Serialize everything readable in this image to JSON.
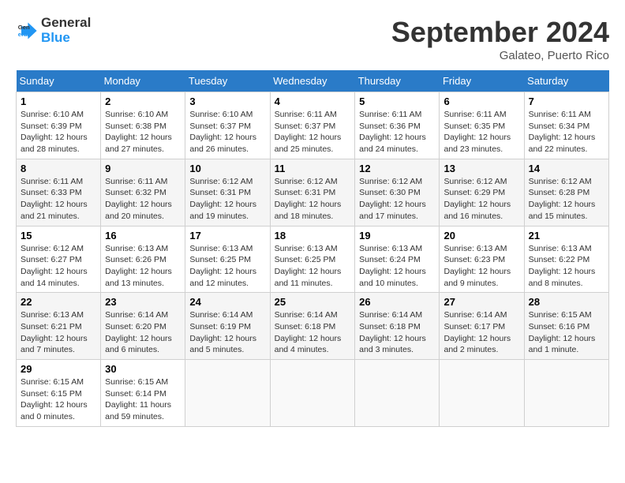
{
  "header": {
    "logo_line1": "General",
    "logo_line2": "Blue",
    "month_title": "September 2024",
    "location": "Galateo, Puerto Rico"
  },
  "days_of_week": [
    "Sunday",
    "Monday",
    "Tuesday",
    "Wednesday",
    "Thursday",
    "Friday",
    "Saturday"
  ],
  "weeks": [
    [
      {
        "day": "1",
        "sunrise": "6:10 AM",
        "sunset": "6:39 PM",
        "daylight": "12 hours and 28 minutes."
      },
      {
        "day": "2",
        "sunrise": "6:10 AM",
        "sunset": "6:38 PM",
        "daylight": "12 hours and 27 minutes."
      },
      {
        "day": "3",
        "sunrise": "6:10 AM",
        "sunset": "6:37 PM",
        "daylight": "12 hours and 26 minutes."
      },
      {
        "day": "4",
        "sunrise": "6:11 AM",
        "sunset": "6:37 PM",
        "daylight": "12 hours and 25 minutes."
      },
      {
        "day": "5",
        "sunrise": "6:11 AM",
        "sunset": "6:36 PM",
        "daylight": "12 hours and 24 minutes."
      },
      {
        "day": "6",
        "sunrise": "6:11 AM",
        "sunset": "6:35 PM",
        "daylight": "12 hours and 23 minutes."
      },
      {
        "day": "7",
        "sunrise": "6:11 AM",
        "sunset": "6:34 PM",
        "daylight": "12 hours and 22 minutes."
      }
    ],
    [
      {
        "day": "8",
        "sunrise": "6:11 AM",
        "sunset": "6:33 PM",
        "daylight": "12 hours and 21 minutes."
      },
      {
        "day": "9",
        "sunrise": "6:11 AM",
        "sunset": "6:32 PM",
        "daylight": "12 hours and 20 minutes."
      },
      {
        "day": "10",
        "sunrise": "6:12 AM",
        "sunset": "6:31 PM",
        "daylight": "12 hours and 19 minutes."
      },
      {
        "day": "11",
        "sunrise": "6:12 AM",
        "sunset": "6:31 PM",
        "daylight": "12 hours and 18 minutes."
      },
      {
        "day": "12",
        "sunrise": "6:12 AM",
        "sunset": "6:30 PM",
        "daylight": "12 hours and 17 minutes."
      },
      {
        "day": "13",
        "sunrise": "6:12 AM",
        "sunset": "6:29 PM",
        "daylight": "12 hours and 16 minutes."
      },
      {
        "day": "14",
        "sunrise": "6:12 AM",
        "sunset": "6:28 PM",
        "daylight": "12 hours and 15 minutes."
      }
    ],
    [
      {
        "day": "15",
        "sunrise": "6:12 AM",
        "sunset": "6:27 PM",
        "daylight": "12 hours and 14 minutes."
      },
      {
        "day": "16",
        "sunrise": "6:13 AM",
        "sunset": "6:26 PM",
        "daylight": "12 hours and 13 minutes."
      },
      {
        "day": "17",
        "sunrise": "6:13 AM",
        "sunset": "6:25 PM",
        "daylight": "12 hours and 12 minutes."
      },
      {
        "day": "18",
        "sunrise": "6:13 AM",
        "sunset": "6:25 PM",
        "daylight": "12 hours and 11 minutes."
      },
      {
        "day": "19",
        "sunrise": "6:13 AM",
        "sunset": "6:24 PM",
        "daylight": "12 hours and 10 minutes."
      },
      {
        "day": "20",
        "sunrise": "6:13 AM",
        "sunset": "6:23 PM",
        "daylight": "12 hours and 9 minutes."
      },
      {
        "day": "21",
        "sunrise": "6:13 AM",
        "sunset": "6:22 PM",
        "daylight": "12 hours and 8 minutes."
      }
    ],
    [
      {
        "day": "22",
        "sunrise": "6:13 AM",
        "sunset": "6:21 PM",
        "daylight": "12 hours and 7 minutes."
      },
      {
        "day": "23",
        "sunrise": "6:14 AM",
        "sunset": "6:20 PM",
        "daylight": "12 hours and 6 minutes."
      },
      {
        "day": "24",
        "sunrise": "6:14 AM",
        "sunset": "6:19 PM",
        "daylight": "12 hours and 5 minutes."
      },
      {
        "day": "25",
        "sunrise": "6:14 AM",
        "sunset": "6:18 PM",
        "daylight": "12 hours and 4 minutes."
      },
      {
        "day": "26",
        "sunrise": "6:14 AM",
        "sunset": "6:18 PM",
        "daylight": "12 hours and 3 minutes."
      },
      {
        "day": "27",
        "sunrise": "6:14 AM",
        "sunset": "6:17 PM",
        "daylight": "12 hours and 2 minutes."
      },
      {
        "day": "28",
        "sunrise": "6:15 AM",
        "sunset": "6:16 PM",
        "daylight": "12 hours and 1 minute."
      }
    ],
    [
      {
        "day": "29",
        "sunrise": "6:15 AM",
        "sunset": "6:15 PM",
        "daylight": "12 hours and 0 minutes."
      },
      {
        "day": "30",
        "sunrise": "6:15 AM",
        "sunset": "6:14 PM",
        "daylight": "11 hours and 59 minutes."
      },
      null,
      null,
      null,
      null,
      null
    ]
  ],
  "labels": {
    "sunrise_prefix": "Sunrise: ",
    "sunset_prefix": "Sunset: ",
    "daylight_prefix": "Daylight: "
  }
}
